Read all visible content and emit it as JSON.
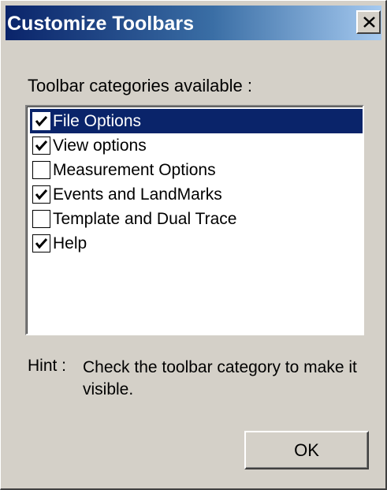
{
  "window": {
    "title": "Customize Toolbars"
  },
  "categories": {
    "label": "Toolbar categories available :",
    "items": [
      {
        "label": "File Options",
        "checked": true,
        "selected": true
      },
      {
        "label": "View options",
        "checked": true,
        "selected": false
      },
      {
        "label": "Measurement Options",
        "checked": false,
        "selected": false
      },
      {
        "label": "Events and LandMarks",
        "checked": true,
        "selected": false
      },
      {
        "label": "Template and Dual Trace",
        "checked": false,
        "selected": false
      },
      {
        "label": "Help",
        "checked": true,
        "selected": false
      }
    ]
  },
  "hint": {
    "label": "Hint :",
    "text": "Check the toolbar category to make it visible."
  },
  "buttons": {
    "ok_label": "OK"
  },
  "colors": {
    "dialog_face": "#d4d0c8",
    "title_active": "#0a246a",
    "selection": "#0a246a"
  }
}
